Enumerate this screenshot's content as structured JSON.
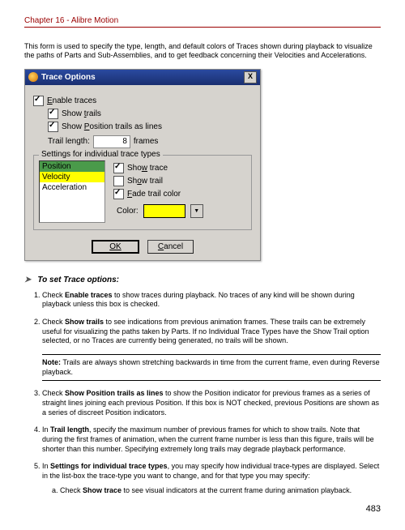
{
  "header": {
    "chapter": "Chapter 16 - Alibre Motion"
  },
  "intro": "This form is used to specify the type, length, and default colors of Traces shown during playback to visualize the paths of Parts and Sub-Assemblies, and to get feedback concerning their Velocities and Accelerations.",
  "dialog": {
    "title": "Trace Options",
    "close": "X",
    "enable_traces": "Enable traces",
    "show_trails": "Show trails",
    "show_pos_trails_lines": "Show Position trails as lines",
    "trail_length_label": "Trail length:",
    "trail_length_value": "8",
    "trail_length_units": "frames",
    "legend": "Settings for individual trace types",
    "list": {
      "position": "Position",
      "velocity": "Velocity",
      "acceleration": "Acceleration"
    },
    "show_trace": "Show trace",
    "show_trail": "Show trail",
    "fade_trail_color": "Fade trail color",
    "color_label": "Color:",
    "ok": "OK",
    "cancel": "Cancel",
    "color_dd": "▼"
  },
  "section_head": "To set Trace options:",
  "steps": {
    "s1_a": "Check ",
    "s1_b": "Enable traces",
    "s1_c": " to show traces during playback. No traces of any kind will be shown during playback unless this box is checked.",
    "s2_a": "Check ",
    "s2_b": "Show trails",
    "s2_c": " to see indications from previous animation frames. These trails can be extremely useful for visualizing the paths taken by Parts. If no Individual Trace Types have the Show Trail option selected, or no Traces are currently being generated, no trails will be shown.",
    "note_a": "Note:",
    "note_b": " Trails are always shown stretching backwards in time from the current frame, even during Reverse playback.",
    "s3_a": "Check ",
    "s3_b": "Show Position trails as lines",
    "s3_c": " to show the Position indicator for previous frames as a series of straight lines joining each previous Position. If this box is NOT checked, previous Positions are shown as a series of discreet Position indicators.",
    "s4_a": "In ",
    "s4_b": "Trail length",
    "s4_c": ", specify the maximum number of previous frames for which to show trails. Note that during the first frames of animation, when the current frame number is less than this figure, trails will be shorter than this number. Specifying extremely long trails may degrade playback performance.",
    "s5_a": "In ",
    "s5_b": "Settings for individual trace types",
    "s5_c": ", you may specify how individual trace-types are displayed. Select in the list-box the trace-type you want to change, and for that type you may specify:",
    "s5a_a": "Check ",
    "s5a_b": "Show trace",
    "s5a_c": " to see visual indicators at the current frame during animation playback."
  },
  "page_number": "483"
}
